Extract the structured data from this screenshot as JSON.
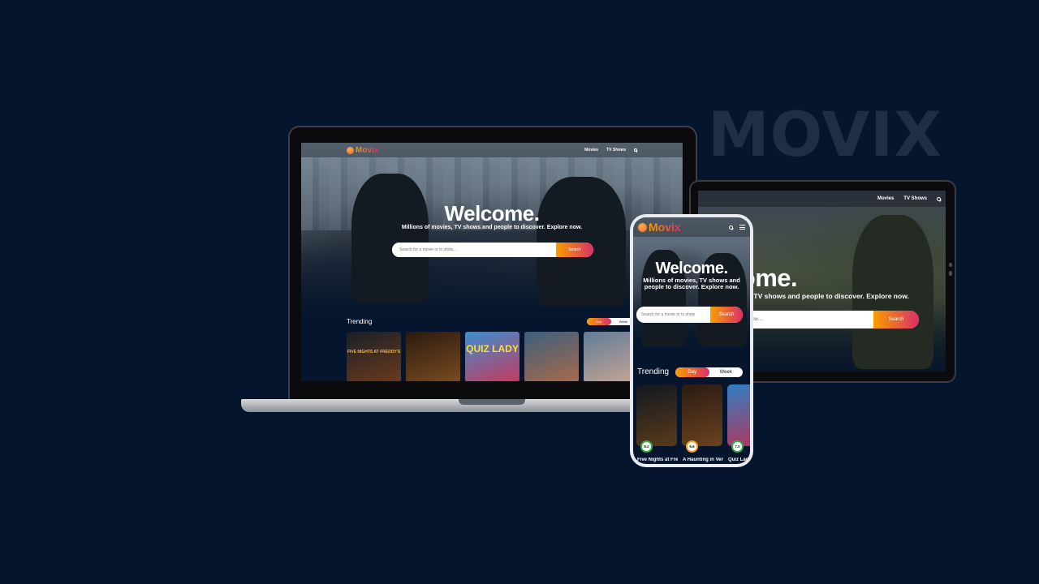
{
  "brand_watermark": "MOVIX",
  "app": {
    "logo_text": "Movix"
  },
  "nav": {
    "movies": "Movies",
    "tv_shows": "TV Shows"
  },
  "hero": {
    "title": "Welcome.",
    "subtitle": "Millions of movies, TV shows and people to discover. Explore now.",
    "search_placeholder": "Search for a movie or tv show....",
    "search_button": "Search"
  },
  "tablet_search_value": "show....",
  "phone_search_placeholder": "Search for a movie or tv show",
  "trending": {
    "title": "Trending",
    "toggle": [
      "Day",
      "Week"
    ],
    "active": "Day",
    "laptop_posters": [
      {
        "label": "FIVE NIGHTS AT FREDDY'S",
        "colors": [
          "#1a1f28",
          "#6b3a1c"
        ]
      },
      {
        "label": "",
        "colors": [
          "#2a1a10",
          "#7a4b20"
        ]
      },
      {
        "label": "QUIZ LADY",
        "colors": [
          "#3a8fd0",
          "#c7395e"
        ]
      },
      {
        "label": "",
        "colors": [
          "#3b5f7e",
          "#a86a4a"
        ]
      },
      {
        "label": "",
        "colors": [
          "#5f7d99",
          "#c7a493"
        ]
      }
    ],
    "phone_items": [
      {
        "title": "Five Nights at Freddy's",
        "rating": "8.2",
        "colors": [
          "#111822",
          "#5a3a1a"
        ]
      },
      {
        "title": "A Haunting in Venice",
        "rating": "6.6",
        "colors": [
          "#2b1b12",
          "#6a4220"
        ]
      },
      {
        "title": "Quiz Lady",
        "rating": "7.0",
        "colors": [
          "#2f7fc4",
          "#b5345a"
        ]
      }
    ]
  }
}
